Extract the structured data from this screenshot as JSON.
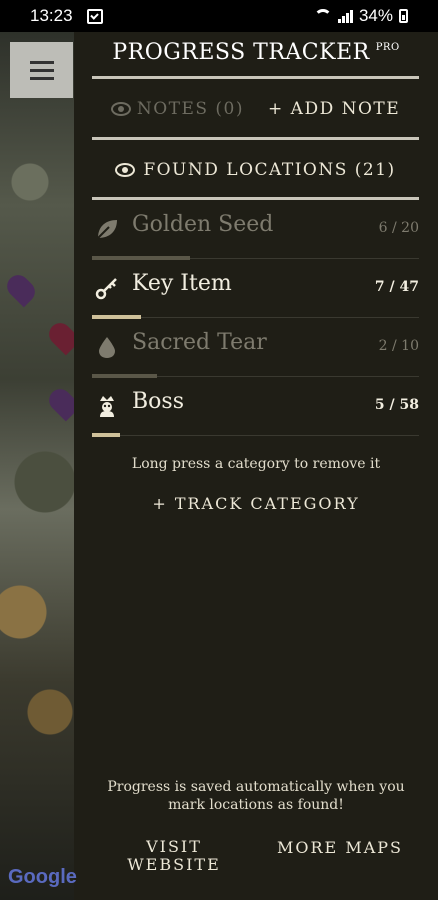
{
  "status": {
    "time": "13:23",
    "battery": "34%"
  },
  "map": {
    "attribution": "Google"
  },
  "drawer": {
    "title": "PROGRESS TRACKER",
    "badge": "PRO",
    "notes_label": "NOTES (0)",
    "add_note_label": "+ ADD NOTE",
    "found_label": "FOUND LOCATIONS (21)",
    "categories": [
      {
        "name": "Golden Seed",
        "count": "6 / 20",
        "found": 6,
        "total": 20,
        "icon": "leaf-icon",
        "active": false
      },
      {
        "name": "Key Item",
        "count": "7 / 47",
        "found": 7,
        "total": 47,
        "icon": "key-icon",
        "active": true
      },
      {
        "name": "Sacred Tear",
        "count": "2 / 10",
        "found": 2,
        "total": 10,
        "icon": "drop-icon",
        "active": false
      },
      {
        "name": "Boss",
        "count": "5 / 58",
        "found": 5,
        "total": 58,
        "icon": "boss-crown-icon",
        "active": true
      }
    ],
    "hint": "Long press a category to remove it",
    "track_category_label": "+ TRACK CATEGORY",
    "footer_note": "Progress is saved automatically when you mark locations as found!",
    "visit_website_label": "VISIT WEBSITE",
    "more_maps_label": "MORE MAPS"
  },
  "colors": {
    "accent": "#cfc19a",
    "background": "#1f1e16"
  }
}
